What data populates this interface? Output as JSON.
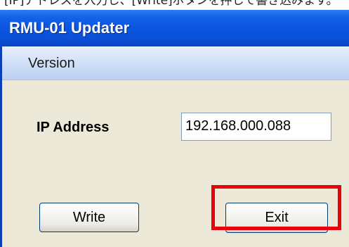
{
  "caption": {
    "text": "[IP]アドレスを入力し、[Write]ボタンを押して書き込みます。"
  },
  "window": {
    "title": "RMU-01 Updater"
  },
  "menu": {
    "items": [
      {
        "label": "Version"
      }
    ]
  },
  "form": {
    "ip_label": "IP Address",
    "ip_value": "192.168.000.088"
  },
  "buttons": {
    "write_label": "Write",
    "exit_label": "Exit"
  },
  "annotation": {
    "highlight_color": "#e8000b",
    "highlighted_control": "Exit"
  },
  "colors": {
    "titlebar": "#0b55e0",
    "menubar": "#cfdef8",
    "window_body": "#ece9d8",
    "input_border": "#7f9db9",
    "button_border": "#003c74"
  }
}
